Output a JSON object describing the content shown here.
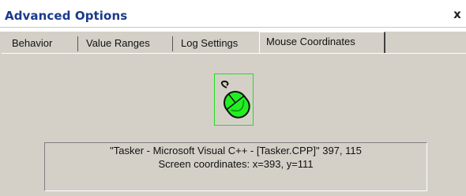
{
  "window": {
    "title": "Advanced Options",
    "close_label": "x"
  },
  "tabs": [
    {
      "label": "Behavior",
      "active": false
    },
    {
      "label": "Value Ranges",
      "active": false
    },
    {
      "label": "Log Settings",
      "active": false
    },
    {
      "label": "Mouse Coordinates",
      "active": true
    }
  ],
  "panel": {
    "icon": "mouse-icon",
    "window_info": "\"Tasker - Microsoft Visual C++ - [Tasker.CPP]\" 397, 115",
    "screen_coords": "Screen coordinates: x=393, y=111"
  },
  "colors": {
    "title_text": "#1a3a8c",
    "dialog_bg": "#d4d0c8",
    "mouse_body": "#22ee22",
    "icon_frame": "#22dd22"
  }
}
